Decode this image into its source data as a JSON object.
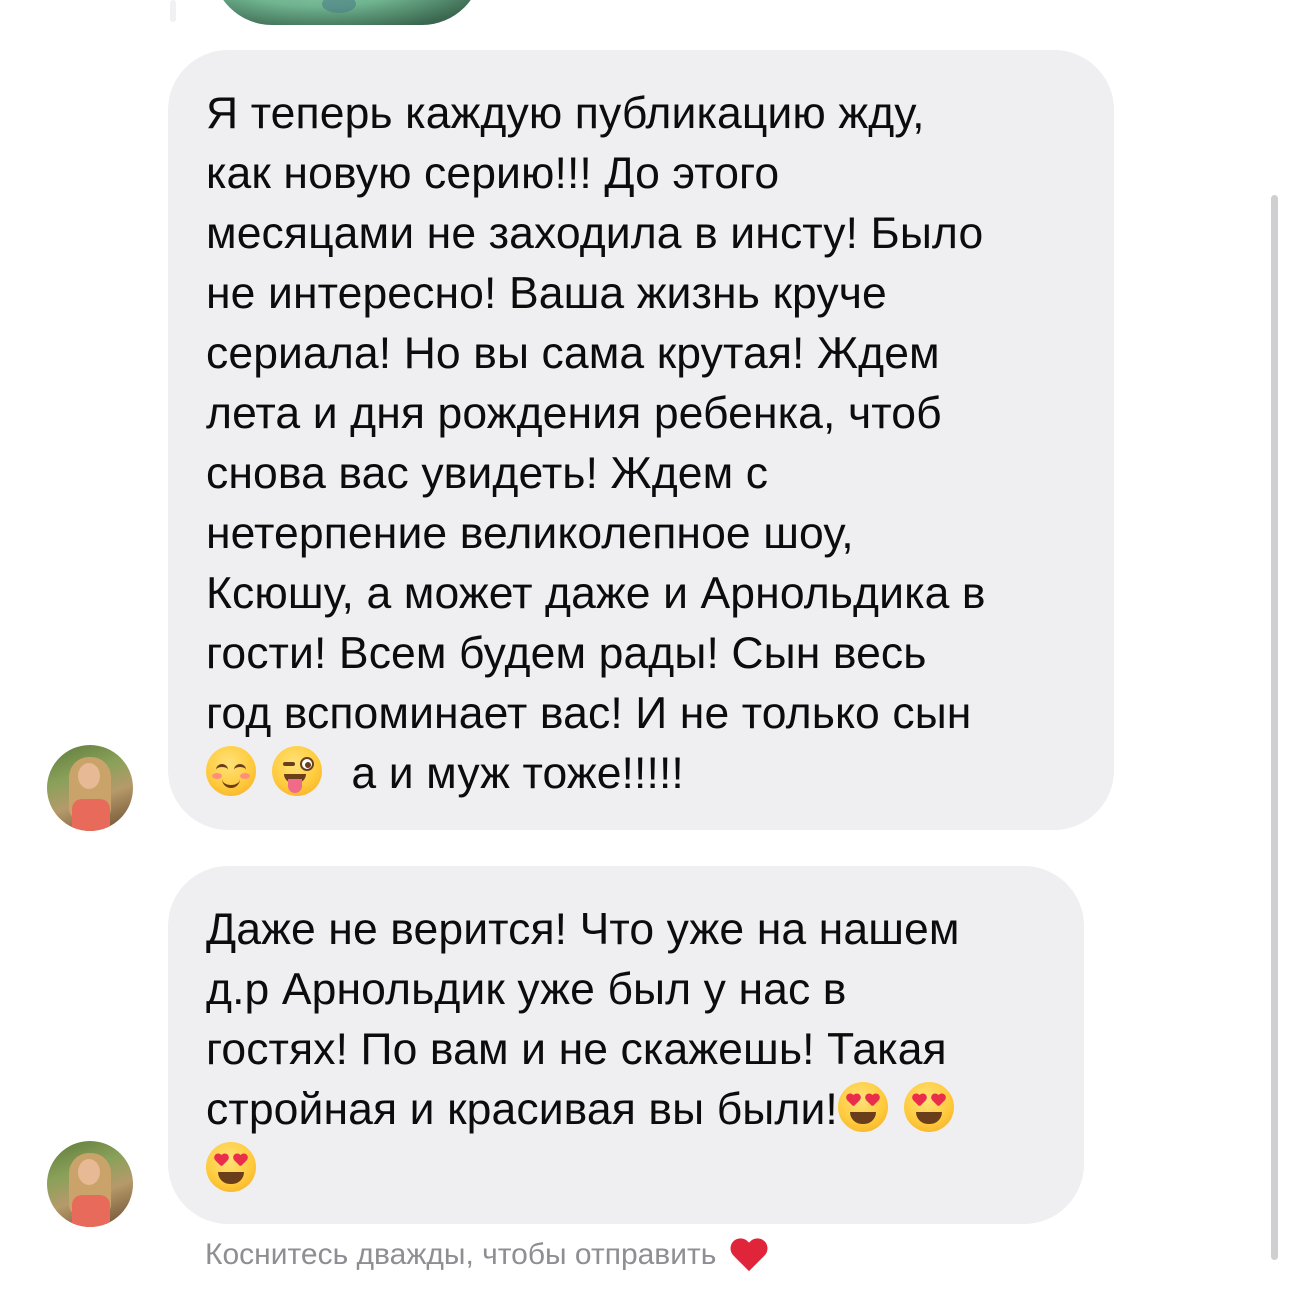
{
  "messages": [
    {
      "text_lines": [
        "Я теперь каждую публикацию жду,",
        "как новую серию!!! До этого",
        "месяцами не заходила в инсту! Было",
        "не интересно! Ваша жизнь круче",
        "сериала! Но вы сама крутая! Ждем",
        "лета и дня рождения ребенка, чтоб",
        "снова вас увидеть! Ждем с",
        "нетерпение великолепное шоу,",
        "Ксюшу, а может даже и Арнольдика в",
        "гости! Всем будем рады! Сын весь",
        "год вспоминает вас! И не только сын"
      ],
      "last_line_emojis": [
        "smiling-face-with-blush-icon",
        "winking-face-with-tongue-icon"
      ],
      "last_line_text": "а и муж тоже!!!!!"
    },
    {
      "text_lines": [
        "Даже не верится! Что уже на нашем",
        "д.р Арнольдик уже был у нас в",
        "гостях! По вам и не скажешь! Такая"
      ],
      "line4_text": "стройная и красивая вы были!",
      "line4_emojis": [
        "heart-eyes-icon",
        "heart-eyes-icon"
      ],
      "line5_emojis": [
        "heart-eyes-icon"
      ]
    }
  ],
  "hint": {
    "text": "Коснитесь дважды, чтобы отправить",
    "icon": "red-heart-icon",
    "color": "#8e8e93",
    "heart_color": "#e0243a"
  },
  "colors": {
    "bubble": "#efeff1",
    "text": "#0c0c0c",
    "background": "#ffffff"
  }
}
